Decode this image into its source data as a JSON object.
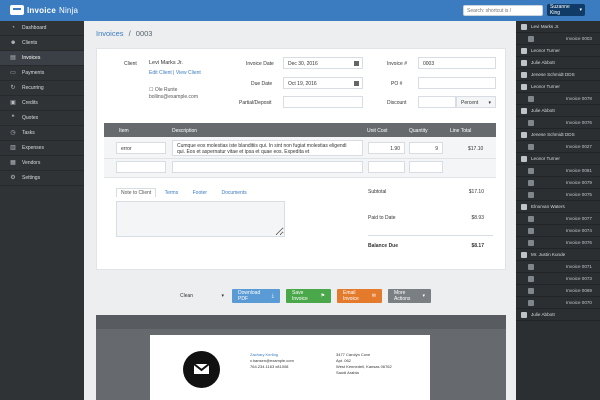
{
  "app": {
    "brand_invoice": "Invoice",
    "brand_ninja": "Ninja",
    "search_placeholder": "Search: shortcut is /",
    "user": "Suzanne King",
    "user_caret": "▾"
  },
  "sidebar": {
    "items": [
      {
        "label": "Dashboard",
        "icon": "tachometer-icon"
      },
      {
        "label": "Clients",
        "icon": "users-icon"
      },
      {
        "label": "Invoices",
        "icon": "file-icon",
        "active": true
      },
      {
        "label": "Payments",
        "icon": "credit-card-icon"
      },
      {
        "label": "Recurring",
        "icon": "recurring-icon"
      },
      {
        "label": "Credits",
        "icon": "credit-icon"
      },
      {
        "label": "Quotes",
        "icon": "quote-icon"
      },
      {
        "label": "Tasks",
        "icon": "clock-icon"
      },
      {
        "label": "Expenses",
        "icon": "expense-icon"
      },
      {
        "label": "Vendors",
        "icon": "vendor-icon"
      },
      {
        "label": "Settings",
        "icon": "gear-icon"
      }
    ]
  },
  "breadcrumb": {
    "section": "Invoices",
    "separator": "/",
    "current": "0003"
  },
  "client": {
    "label": "Client",
    "name": "Levi Marks Jr.",
    "links": "Edit Client | View Client",
    "contact_name": "Ole Runte",
    "contact_email": "bollins@example.com"
  },
  "invoice": {
    "invoice_date_label": "Invoice Date",
    "invoice_date": "Dec 30, 2016",
    "due_date_label": "Due Date",
    "due_date": "Oct 19, 2016",
    "partial_label": "Partial/Deposit",
    "partial": "",
    "invoice_number_label": "Invoice #",
    "invoice_number": "0003",
    "po_label": "PO #",
    "po": "",
    "discount_label": "Discount",
    "discount": "",
    "discount_type": "Percent",
    "discount_caret": "▾"
  },
  "table": {
    "headers": [
      "Item",
      "Description",
      "Unit Cost",
      "Quantity",
      "Line Total"
    ],
    "rows": [
      {
        "item": "error",
        "description": "Cumque eos molestias iste blanditiis qui. In sint non fugiat molestias eligendi",
        "description2": "qui. Eos et aspernatur vitae et ipsa et quae eos. Expedita et",
        "unit_cost": "1.90",
        "quantity": "9",
        "line_total": "$17.10"
      }
    ]
  },
  "notes": {
    "tabs": [
      "Note to Client",
      "Terms",
      "Footer",
      "Documents"
    ]
  },
  "summary": {
    "subtotal_label": "Subtotal",
    "subtotal": "$17.10",
    "paid_label": "Paid to Date",
    "paid": "$8.93",
    "balance_label": "Balance Due",
    "balance": "$8.17"
  },
  "actions": {
    "design": "Clean",
    "download": "Download PDF",
    "save": "Save Invoice",
    "email": "Email Invoice",
    "more": "More Actions",
    "caret": "▾",
    "download_icon": "⤓",
    "save_icon": "⚑",
    "email_icon": "✉"
  },
  "pdf": {
    "company_name": "Zachary Kerling",
    "company_email": "v.hansen@example.com",
    "company_phone": "764.234.1163 x81008",
    "client_address1": "3477 Carolyn Cove",
    "client_address2": "Apt. 062",
    "client_city": "West Kennedell, Kansas 06762",
    "client_country": "Saudi Arabia"
  },
  "recent": [
    {
      "type": "client",
      "label": "Levi Marks Jr."
    },
    {
      "type": "invoice",
      "label": "Invoice 0003"
    },
    {
      "type": "client",
      "label": "Leonor Turner"
    },
    {
      "type": "client",
      "label": "Julie Abbott"
    },
    {
      "type": "client",
      "label": "Jenese Schmidt DDS"
    },
    {
      "type": "client",
      "label": "Leonor Turner"
    },
    {
      "type": "invoice",
      "label": "Invoice 0078"
    },
    {
      "type": "client",
      "label": "Julie Abbott"
    },
    {
      "type": "invoice",
      "label": "Invoice 0076"
    },
    {
      "type": "client",
      "label": "Jenese Schmidt DDS"
    },
    {
      "type": "invoice",
      "label": "Invoice 0027"
    },
    {
      "type": "client",
      "label": "Leonor Turner"
    },
    {
      "type": "invoice",
      "label": "Invoice 0081"
    },
    {
      "type": "invoice",
      "label": "Invoice 0079"
    },
    {
      "type": "invoice",
      "label": "Invoice 0075"
    },
    {
      "type": "client",
      "label": "Elnorvan Waters"
    },
    {
      "type": "invoice",
      "label": "Invoice 0077"
    },
    {
      "type": "invoice",
      "label": "Invoice 0074"
    },
    {
      "type": "invoice",
      "label": "Invoice 0076"
    },
    {
      "type": "client",
      "label": "Mr. Justin Kunde"
    },
    {
      "type": "invoice",
      "label": "Invoice 0071"
    },
    {
      "type": "invoice",
      "label": "Invoice 0073"
    },
    {
      "type": "invoice",
      "label": "Invoice 0069"
    },
    {
      "type": "invoice",
      "label": "Invoice 0070"
    },
    {
      "type": "client",
      "label": "Julie Abbott"
    }
  ],
  "colors": {
    "accent": "#3b7bbf",
    "download": "#5b9bd5",
    "save": "#4aa84a",
    "email": "#e47a2c",
    "more": "#7a7f84"
  }
}
